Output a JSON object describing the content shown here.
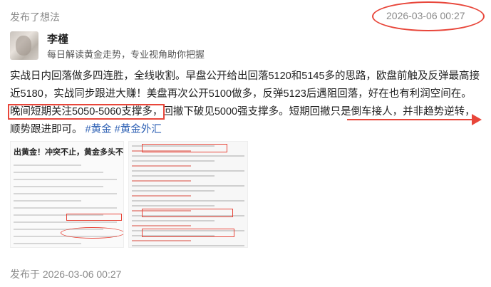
{
  "header": {
    "action_label": "发布了想法",
    "timestamp": "2026-03-06 00:27"
  },
  "author": {
    "name": "李槿",
    "bio": "每日解读黄金走势，专业视角助你把握"
  },
  "post": {
    "text_part1": "实战日内回落做多四连胜，全线收割。早盘公开给出回落5120和5145多的思路，欧盘前触及反弹最高接近5180，实战同步跟进大赚！美盘再次公开5100做多，反弹5123后遇阻回落，好在也有利润空间在。",
    "highlight": "晚间短期关注5050-5060支撑多，",
    "text_part2": "回撤下破见5000强支撑多。短期回撤只是倒车接人，并非趋势逆转，顺势跟进即可。",
    "tags": [
      "#黄金",
      "#黄金外汇"
    ]
  },
  "image_left": {
    "heading": "出黄金！冲突不止，黄金多头不止"
  },
  "footer": {
    "published_label": "发布于",
    "timestamp": "2026-03-06 00:27"
  },
  "colors": {
    "annotation_red": "#e8463a",
    "tag_blue": "#2c5fb3",
    "meta_gray": "#8a8a8a"
  }
}
